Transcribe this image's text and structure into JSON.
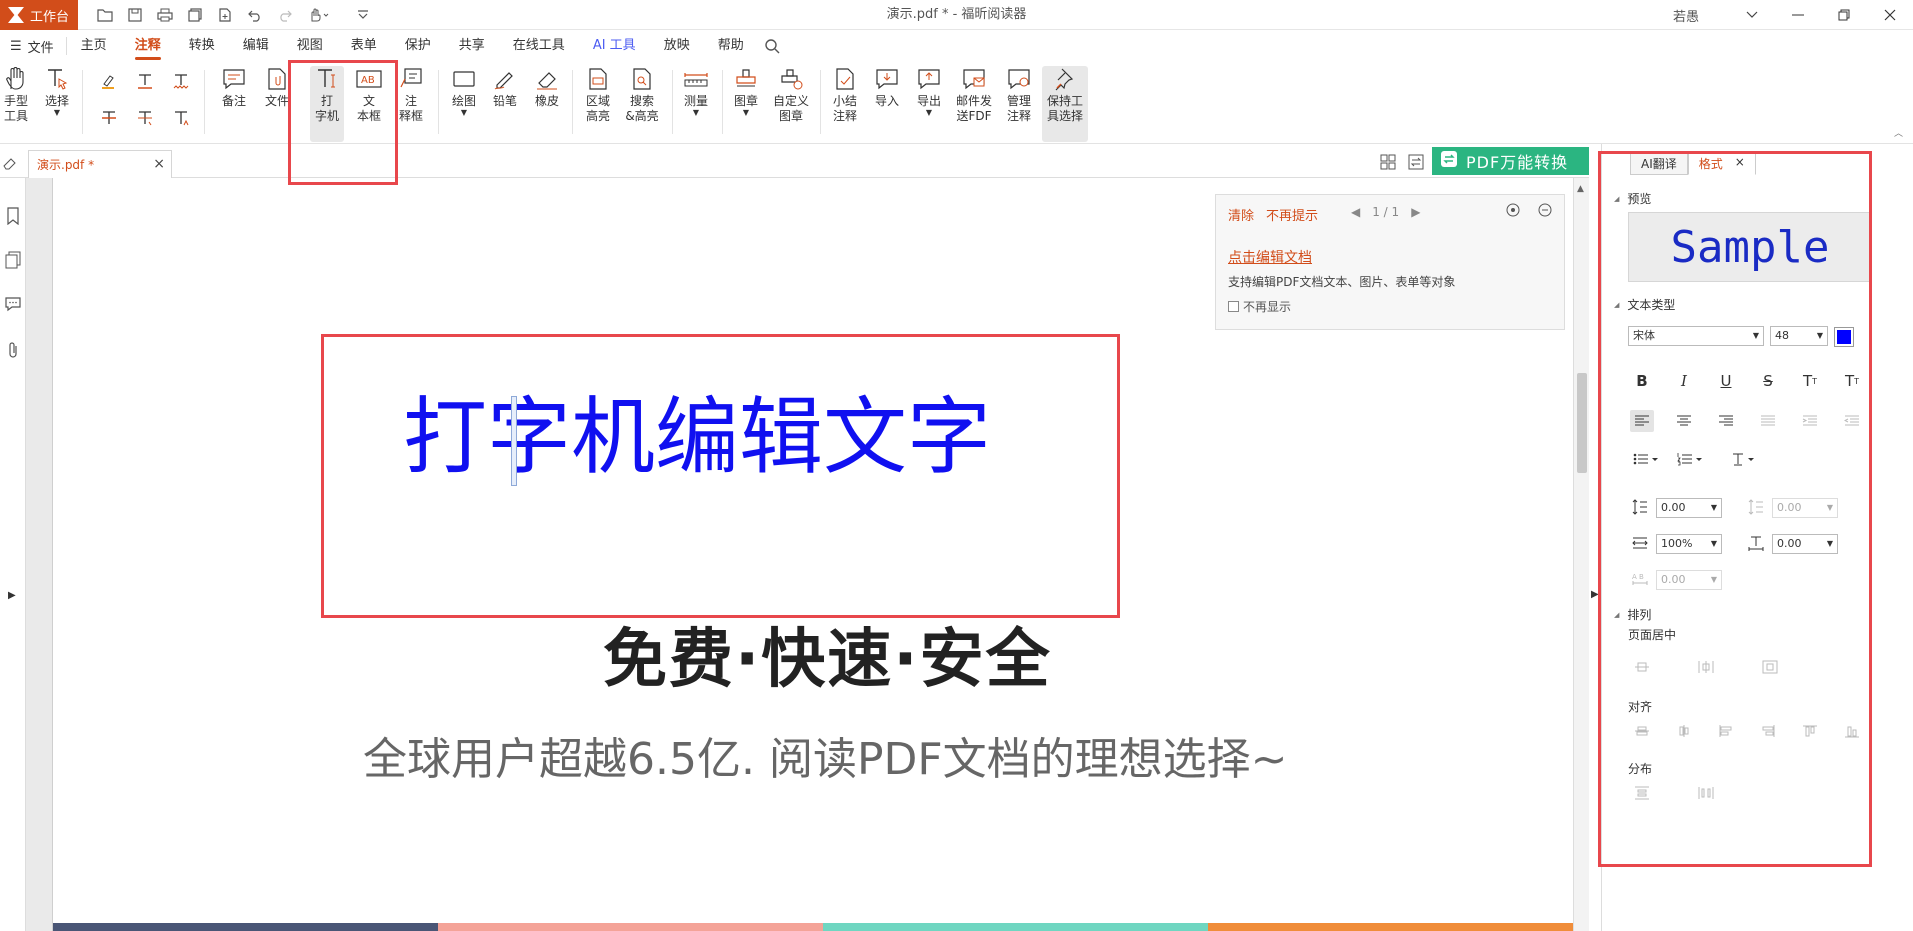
{
  "app": {
    "workbench_label": "工作台",
    "window_title": "演示.pdf * - 福昕阅读器",
    "user_name": "若愚"
  },
  "menu": {
    "file_label": "文件",
    "tabs": [
      "主页",
      "注释",
      "转换",
      "编辑",
      "视图",
      "表单",
      "保护",
      "共享",
      "在线工具",
      "AI 工具",
      "放映",
      "帮助"
    ],
    "active_tab": "注释"
  },
  "ribbon": {
    "hand_tool": "手型\n工具",
    "select_tool": "选择",
    "note": "备注",
    "file": "文件",
    "typewriter": "打\n字机",
    "textbox": "文\n本框",
    "callout": "注\n释框",
    "drawing": "绘图",
    "pencil": "铅笔",
    "eraser": "橡皮",
    "area_highlight": "区域\n高亮",
    "search_highlight": "搜索\n&高亮",
    "measure": "测量",
    "stamp": "图章",
    "custom_stamp": "自定义\n图章",
    "summary": "小结\n注释",
    "import": "导入",
    "export": "导出",
    "email_pdf": "邮件发\n送FDF",
    "manage": "管理\n注释",
    "keep_tool": "保持工\n具选择"
  },
  "doc": {
    "tab_name": "演示.pdf *",
    "convert_button": "PDF万能转换",
    "typed_text": "打字机编辑文字",
    "slogan": "免费·快速·安全",
    "tagline": "全球用户超越6.5亿. 阅读PDF文档的理想选择~",
    "stripe_colors": [
      "#4a5676",
      "#f4a398",
      "#6fd6c1",
      "#f08d3a"
    ]
  },
  "notice": {
    "clear": "清除",
    "no_remind": "不再提示",
    "pager": "1 / 1",
    "link": "点击编辑文档",
    "desc": "支持编辑PDF文档文本、图片、表单等对象",
    "checkbox_label": "不再显示"
  },
  "panel": {
    "tab_translate": "AI翻译",
    "tab_format": "格式",
    "preview_title": "预览",
    "sample_text": "Sample",
    "text_type_title": "文本类型",
    "font_name": "宋体",
    "font_size": "48",
    "font_color": "#0000ff",
    "line_spacing": "0.00",
    "para_spacing": "0.00",
    "scale": "100%",
    "char_spacing": "0.00",
    "word_spacing": "0.00",
    "arrange_title": "排列",
    "page_center": "页面居中",
    "align": "对齐",
    "distribute": "分布"
  },
  "colors": {
    "accent": "#d24d1a",
    "highlight_box": "#e8474c",
    "convert_green": "#2bb581",
    "text_blue": "#1010f0"
  }
}
